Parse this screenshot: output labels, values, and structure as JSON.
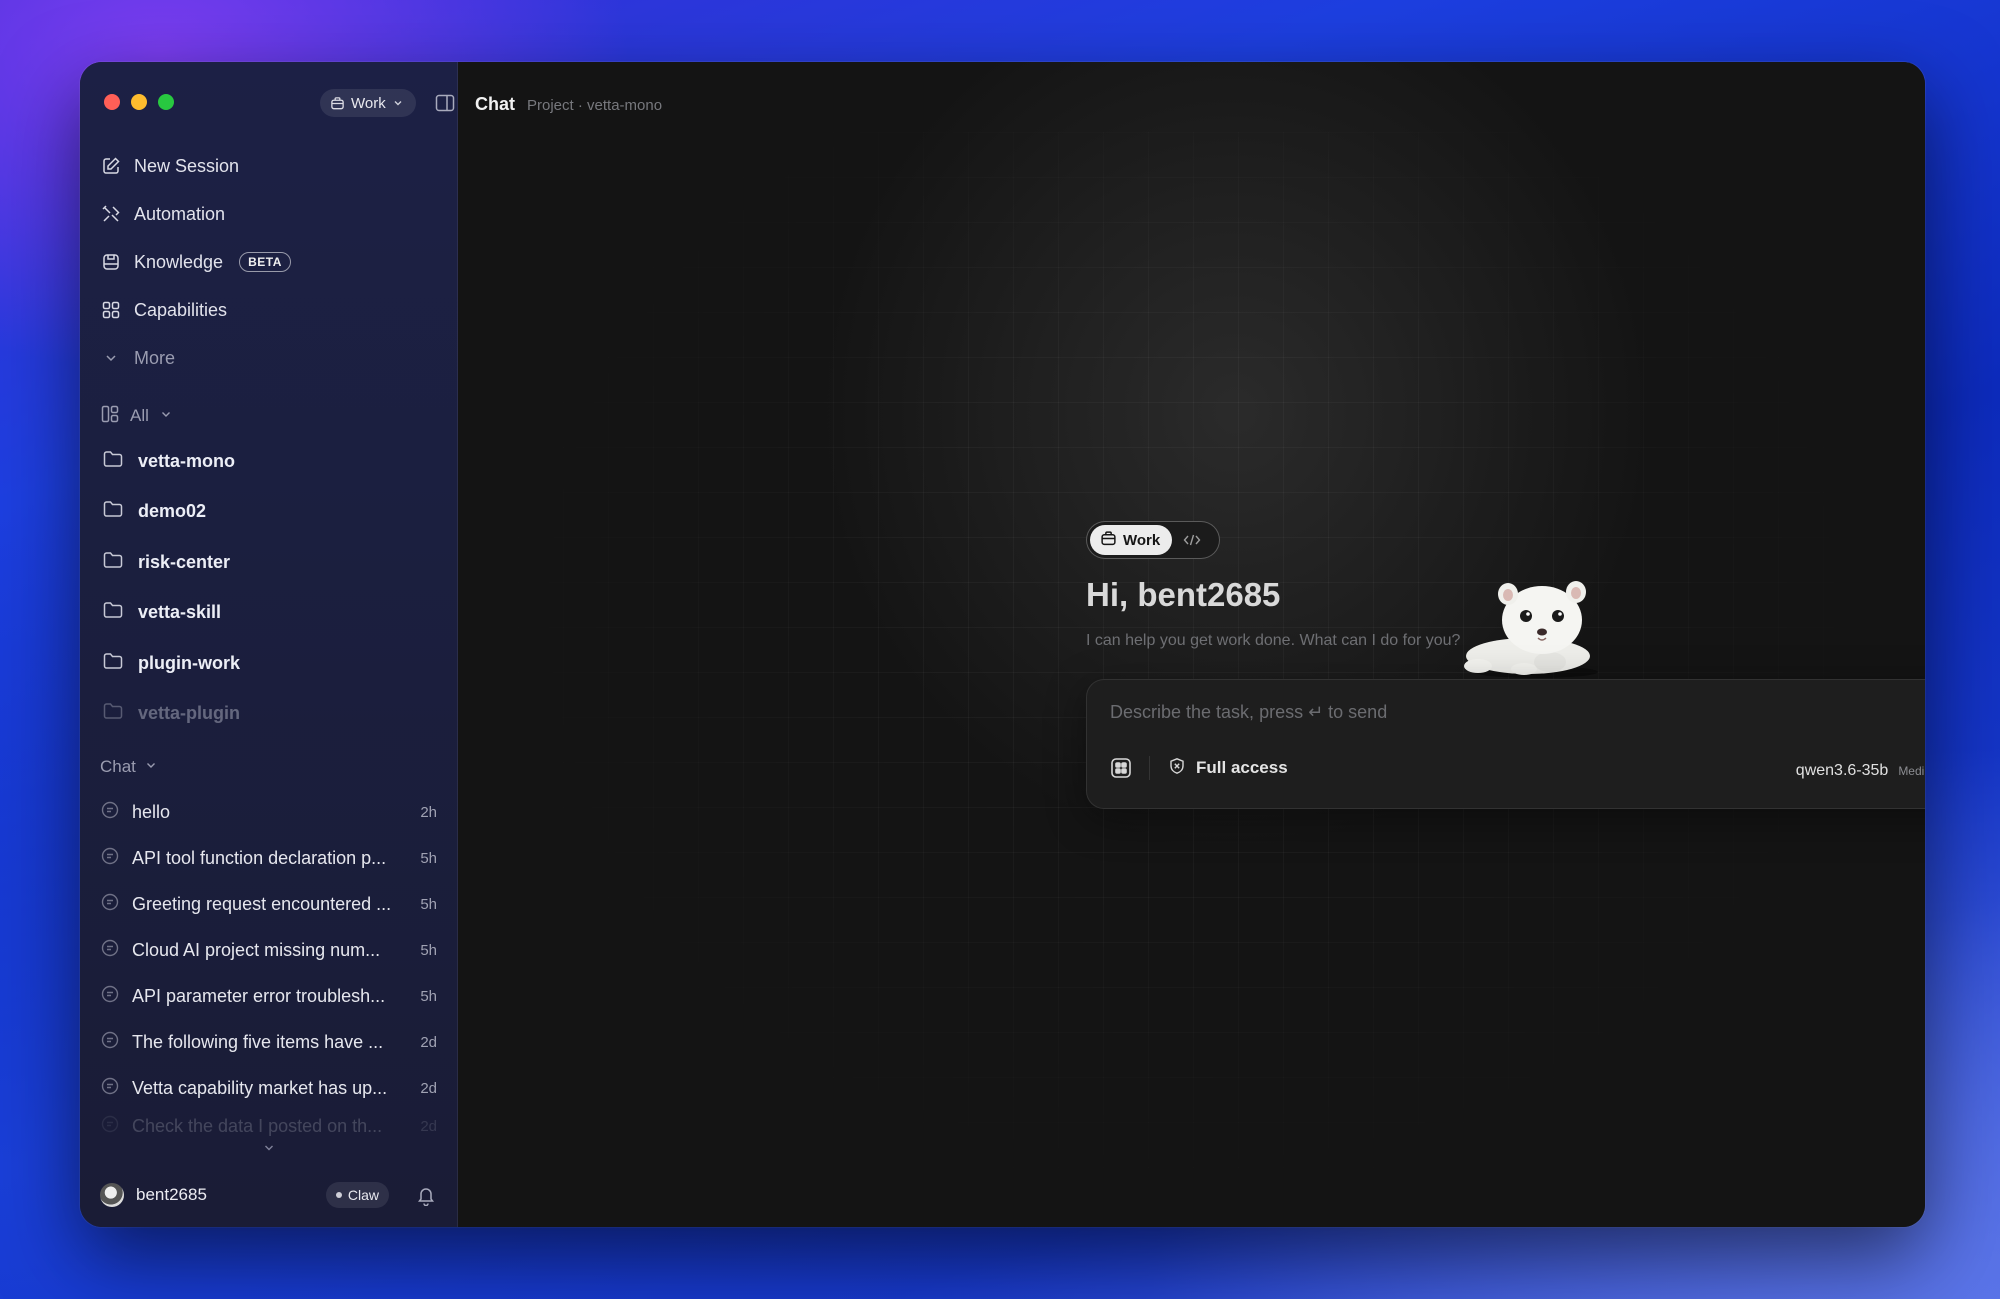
{
  "workspace": {
    "label": "Work"
  },
  "nav": [
    {
      "label": "New Session",
      "icon": "compose-icon"
    },
    {
      "label": "Automation",
      "icon": "automation-icon"
    },
    {
      "label": "Knowledge",
      "icon": "knowledge-icon",
      "badge": "BETA"
    },
    {
      "label": "Capabilities",
      "icon": "grid-icon"
    },
    {
      "label": "More",
      "icon": "chevron-down-icon"
    }
  ],
  "filter": {
    "label": "All"
  },
  "projects": [
    "vetta-mono",
    "demo02",
    "risk-center",
    "vetta-skill",
    "plugin-work",
    "vetta-plugin"
  ],
  "chat_section": {
    "label": "Chat"
  },
  "chats": [
    {
      "title": "hello",
      "age": "2h"
    },
    {
      "title": "API tool function declaration p...",
      "age": "5h"
    },
    {
      "title": "Greeting request encountered ...",
      "age": "5h"
    },
    {
      "title": "Cloud AI project missing num...",
      "age": "5h"
    },
    {
      "title": "API parameter error troublesh...",
      "age": "5h"
    },
    {
      "title": "The following five items have ...",
      "age": "2d"
    },
    {
      "title": "Vetta capability market has up...",
      "age": "2d"
    },
    {
      "title": "Check the data I posted on th...",
      "age": "2d"
    }
  ],
  "user": {
    "name": "bent2685",
    "tag": "Claw"
  },
  "header": {
    "title": "Chat",
    "breadcrumb": "Project · vetta-mono"
  },
  "mode": {
    "work_label": "Work"
  },
  "greeting": {
    "title": "Hi, bent2685",
    "subtitle": "I can help you get work done. What can I do for you?"
  },
  "composer": {
    "placeholder": "Describe the task, press ↵ to send",
    "access_label": "Full access",
    "model": "qwen3.6-35b",
    "effort": "Medium"
  },
  "colors": {
    "close": "#ff5f57",
    "minimize": "#febc2e",
    "maximize": "#28c840",
    "sidebar_bg": "#1c2045",
    "main_bg": "#141414"
  }
}
